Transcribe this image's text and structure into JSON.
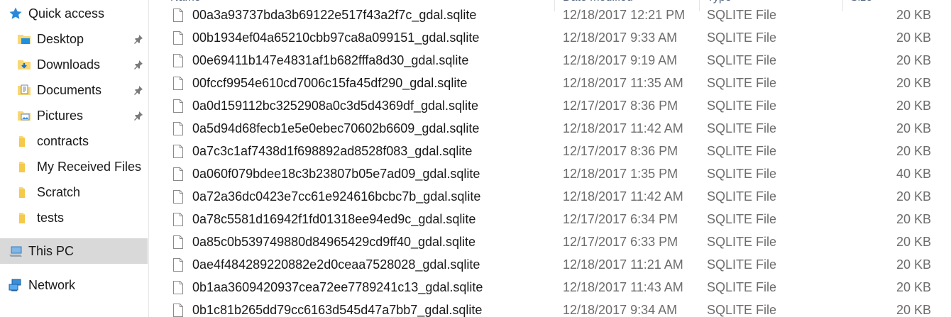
{
  "sidebar": {
    "quick_access": "Quick access",
    "items": [
      {
        "label": "Desktop",
        "icon": "desktop-folder-icon",
        "pinned": true
      },
      {
        "label": "Downloads",
        "icon": "downloads-folder-icon",
        "pinned": true
      },
      {
        "label": "Documents",
        "icon": "documents-folder-icon",
        "pinned": true
      },
      {
        "label": "Pictures",
        "icon": "pictures-folder-icon",
        "pinned": true
      },
      {
        "label": "contracts",
        "icon": "folder-icon",
        "pinned": false
      },
      {
        "label": "My Received Files",
        "icon": "folder-icon",
        "pinned": false
      },
      {
        "label": "Scratch",
        "icon": "folder-icon",
        "pinned": false
      },
      {
        "label": "tests",
        "icon": "folder-icon",
        "pinned": false
      }
    ],
    "this_pc": "This PC",
    "network": "Network"
  },
  "columns": {
    "name": "Name",
    "date": "Date modified",
    "type": "Type",
    "size": "Size"
  },
  "files": [
    {
      "name": "00a3a93737bda3b69122e517f43a2f7c_gdal.sqlite",
      "date": "12/18/2017 12:21 PM",
      "type": "SQLITE File",
      "size": "20 KB"
    },
    {
      "name": "00b1934ef04a65210cbb97ca8a099151_gdal.sqlite",
      "date": "12/18/2017 9:33 AM",
      "type": "SQLITE File",
      "size": "20 KB"
    },
    {
      "name": "00e69411b147e4831af1b682fffa8d30_gdal.sqlite",
      "date": "12/18/2017 9:19 AM",
      "type": "SQLITE File",
      "size": "20 KB"
    },
    {
      "name": "00fccf9954e610cd7006c15fa45df290_gdal.sqlite",
      "date": "12/18/2017 11:35 AM",
      "type": "SQLITE File",
      "size": "20 KB"
    },
    {
      "name": "0a0d159112bc3252908a0c3d5d4369df_gdal.sqlite",
      "date": "12/17/2017 8:36 PM",
      "type": "SQLITE File",
      "size": "20 KB"
    },
    {
      "name": "0a5d94d68fecb1e5e0ebec70602b6609_gdal.sqlite",
      "date": "12/18/2017 11:42 AM",
      "type": "SQLITE File",
      "size": "20 KB"
    },
    {
      "name": "0a7c3c1af7438d1f698892ad8528f083_gdal.sqlite",
      "date": "12/17/2017 8:36 PM",
      "type": "SQLITE File",
      "size": "20 KB"
    },
    {
      "name": "0a060f079bdee18c3b23807b05e7ad09_gdal.sqlite",
      "date": "12/18/2017 1:35 PM",
      "type": "SQLITE File",
      "size": "40 KB"
    },
    {
      "name": "0a72a36dc0423e7cc61e924616bcbc7b_gdal.sqlite",
      "date": "12/18/2017 11:42 AM",
      "type": "SQLITE File",
      "size": "20 KB"
    },
    {
      "name": "0a78c5581d16942f1fd01318ee94ed9c_gdal.sqlite",
      "date": "12/17/2017 6:34 PM",
      "type": "SQLITE File",
      "size": "20 KB"
    },
    {
      "name": "0a85c0b539749880d84965429cd9ff40_gdal.sqlite",
      "date": "12/17/2017 6:33 PM",
      "type": "SQLITE File",
      "size": "20 KB"
    },
    {
      "name": "0ae4f484289220882e2d0ceaa7528028_gdal.sqlite",
      "date": "12/18/2017 11:21 AM",
      "type": "SQLITE File",
      "size": "20 KB"
    },
    {
      "name": "0b1aa3609420937cea72ee7789241c13_gdal.sqlite",
      "date": "12/18/2017 11:43 AM",
      "type": "SQLITE File",
      "size": "20 KB"
    },
    {
      "name": "0b1c81b265dd79cc6163d545d47a7bb7_gdal.sqlite",
      "date": "12/18/2017 9:34 AM",
      "type": "SQLITE File",
      "size": "20 KB"
    }
  ],
  "colors": {
    "selection": "#d9d9d9",
    "folder": "#f8d775",
    "header_text": "#4c607a",
    "secondary_text": "#6d6d6d"
  }
}
